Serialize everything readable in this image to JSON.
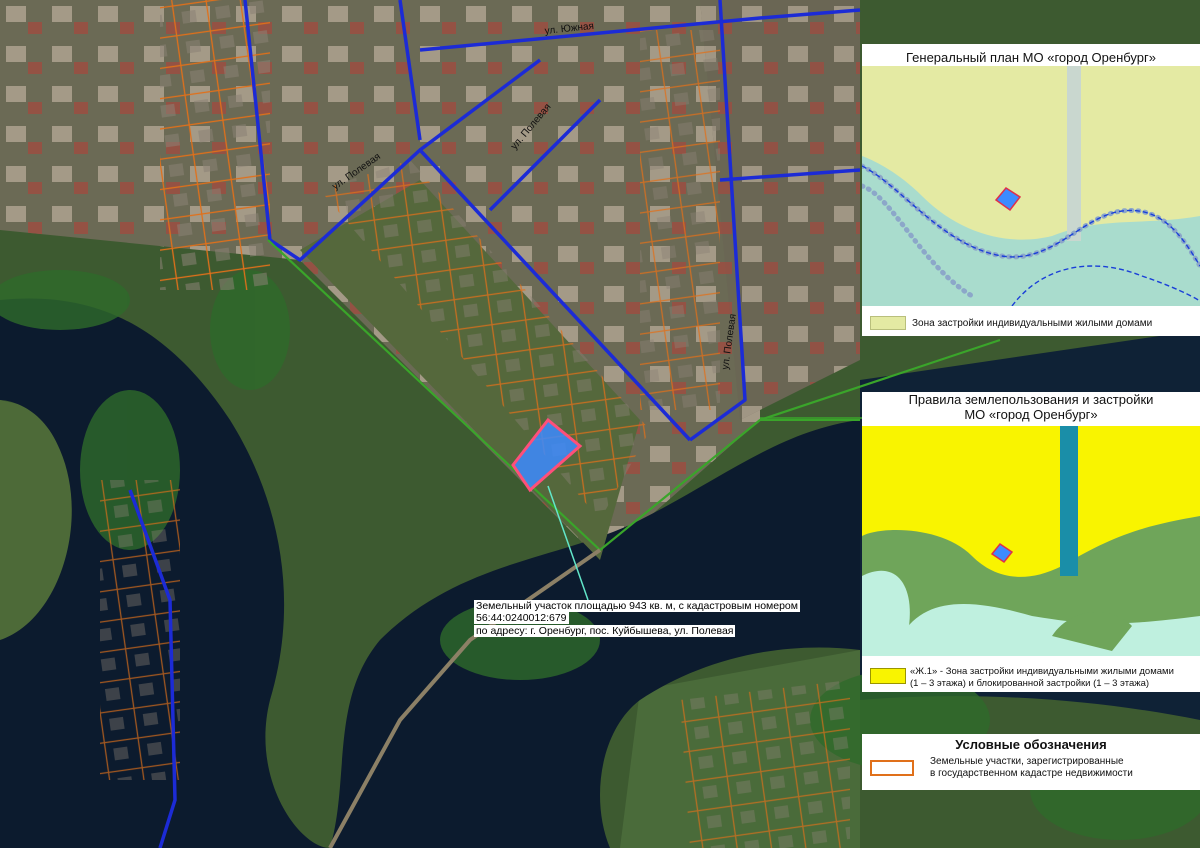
{
  "map": {
    "street_labels": [
      "ул. Южная",
      "ул. Полевая",
      "ул. Полевая",
      "ул. Полевая"
    ],
    "callout": {
      "line1": "Земельный участок площадью 943 кв. м, с кадастровым номером",
      "line2": "56:44:0240012:679",
      "line3": "по адресу: г. Оренбург, пос. Куйбышева, ул. Полевая"
    },
    "colors": {
      "street_line": "#1c2bd6",
      "boundary_line": "#3aa52a",
      "parcel_outline": "#e0701a",
      "target_fill": "#3d8bff",
      "target_outline": "#ff4f7a",
      "pointer": "#62e6c9",
      "water": "#0c1b2e"
    }
  },
  "genplan": {
    "title": "Генеральный план МО «город Оренбург»",
    "legend": "Зона застройки индивидуальными жилыми домами",
    "colors": {
      "zone": "#e4eaa3",
      "bg": "#a9dccd",
      "dots": "#8ca7c9",
      "line": "#1a3fd8"
    }
  },
  "pzz": {
    "title_line1": "Правила землепользования и застройки",
    "title_line2": "МО «город Оренбург»",
    "legend_line1": "«Ж.1» - Зона застройки индивидуальными жилыми домами",
    "legend_line2": "(1 – 3 этажа) и блокированной застройки (1 – 3 этажа)",
    "colors": {
      "zone": "#f9f400",
      "green": "#6fa55a",
      "light": "#bff0df",
      "road": "#1a8ea8"
    }
  },
  "legend": {
    "title": "Условные обозначения",
    "item_line1": "Земельные участки, зарегистрированные",
    "item_line2": "в государственном кадастре недвижимости",
    "color": "#e0701a"
  }
}
